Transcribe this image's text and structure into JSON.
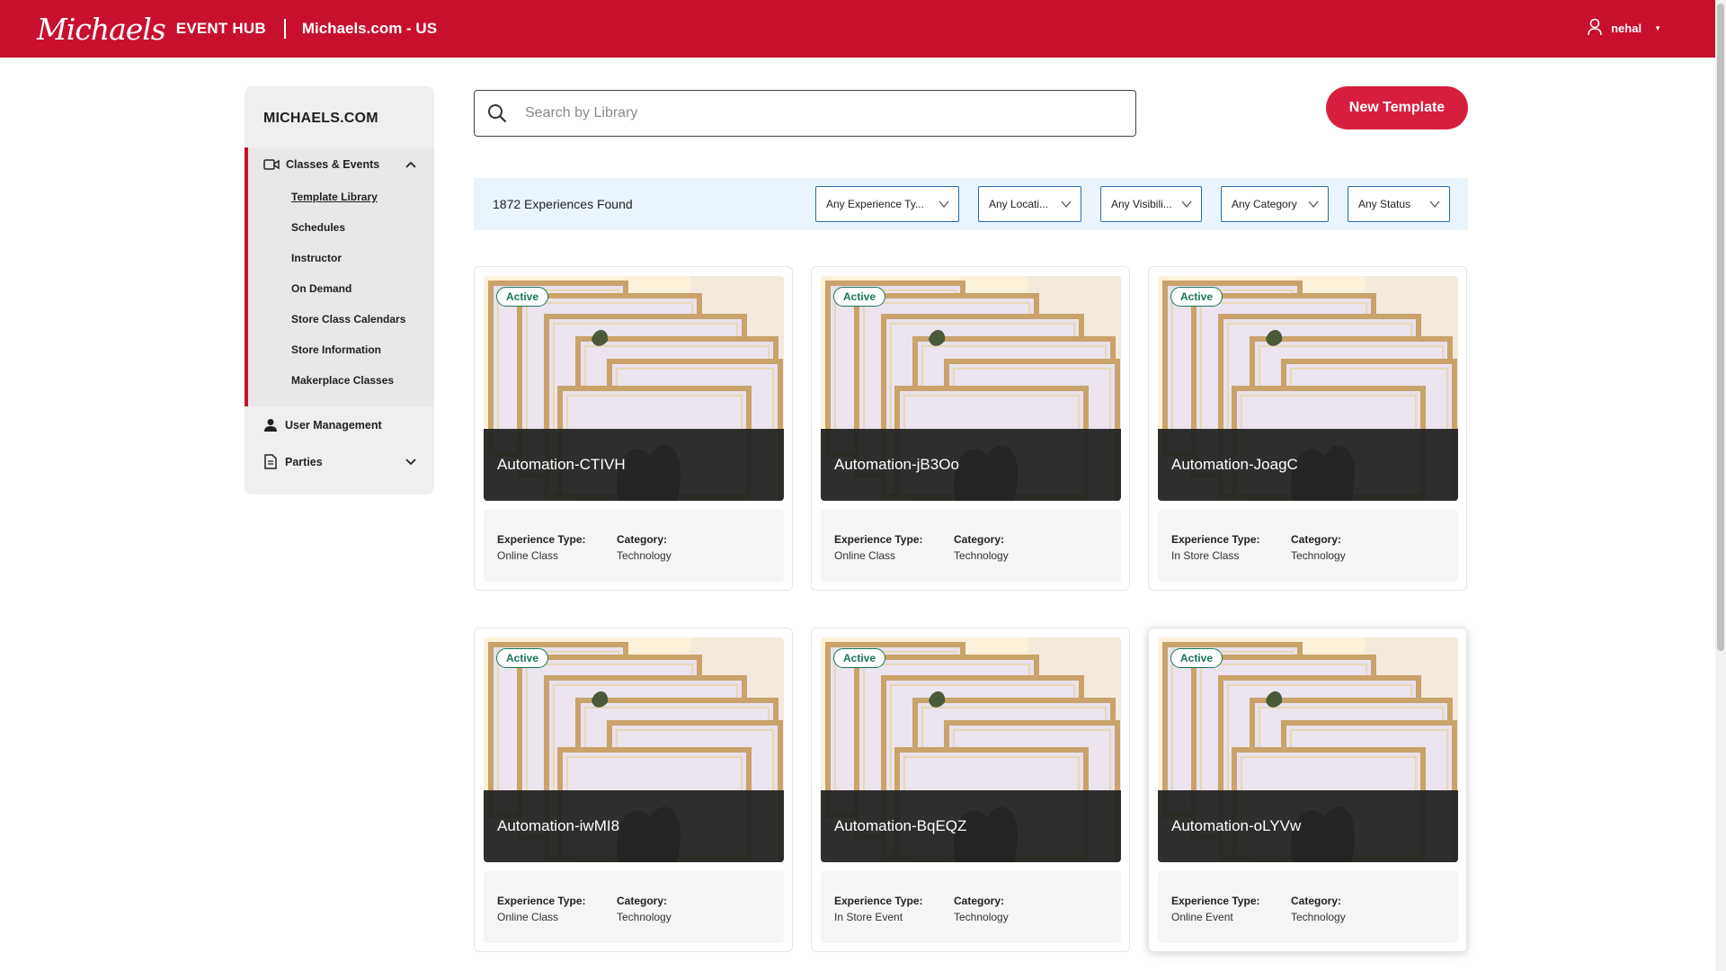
{
  "header": {
    "logo": "Michaels",
    "app_name": "EVENT HUB",
    "site": "Michaels.com - US",
    "user": "nehal"
  },
  "sidebar": {
    "brand": "MICHAELS.COM",
    "group": {
      "label": "Classes & Events",
      "items": [
        "Template Library",
        "Schedules",
        "Instructor",
        "On Demand",
        "Store Class Calendars",
        "Store Information",
        "Makerplace Classes"
      ]
    },
    "user_management": "User Management",
    "parties": "Parties"
  },
  "search": {
    "placeholder": "Search by Library"
  },
  "new_template_label": "New Template",
  "results": {
    "count_text": "1872 Experiences Found",
    "filters": [
      "Any Experience Ty...",
      "Any Locati...",
      "Any Visibili...",
      "Any Category",
      "Any Status"
    ]
  },
  "labels": {
    "experience_type": "Experience Type:",
    "category": "Category:"
  },
  "cards": [
    {
      "status": "Active",
      "title": "Automation-CTIVH",
      "experience_type": "Online Class",
      "category": "Technology"
    },
    {
      "status": "Active",
      "title": "Automation-jB3Oo",
      "experience_type": "Online Class",
      "category": "Technology"
    },
    {
      "status": "Active",
      "title": "Automation-JoagC",
      "experience_type": "In Store Class",
      "category": "Technology"
    },
    {
      "status": "Active",
      "title": "Automation-iwMI8",
      "experience_type": "Online Class",
      "category": "Technology"
    },
    {
      "status": "Active",
      "title": "Automation-BqEQZ",
      "experience_type": "In Store Event",
      "category": "Technology"
    },
    {
      "status": "Active",
      "title": "Automation-oLYVw",
      "experience_type": "Online Event",
      "category": "Technology"
    }
  ],
  "colors": {
    "brand_red": "#c8102e",
    "button_red": "#d81e3e",
    "active_green": "#19745c",
    "filter_bar": "#e9f4fc"
  }
}
